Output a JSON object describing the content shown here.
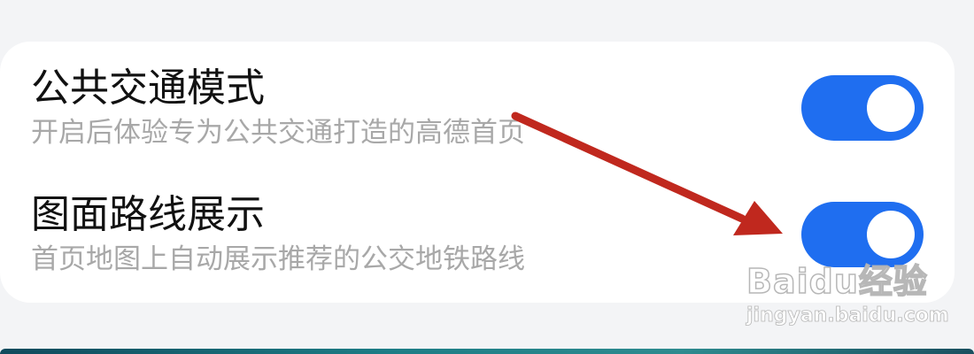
{
  "settings": [
    {
      "title": "公共交通模式",
      "description": "开启后体验专为公共交通打造的高德首页",
      "enabled": true
    },
    {
      "title": "图面路线展示",
      "description": "首页地图上自动展示推荐的公交地铁路线",
      "enabled": true
    }
  ],
  "colors": {
    "toggle_on": "#1f6ef0",
    "annotation_arrow": "#c0281e",
    "card_background": "#ffffff",
    "page_background": "#f3f4f6"
  },
  "watermark": {
    "logo_text": "Baidu经验",
    "url": "jingyan.baidu.com"
  }
}
